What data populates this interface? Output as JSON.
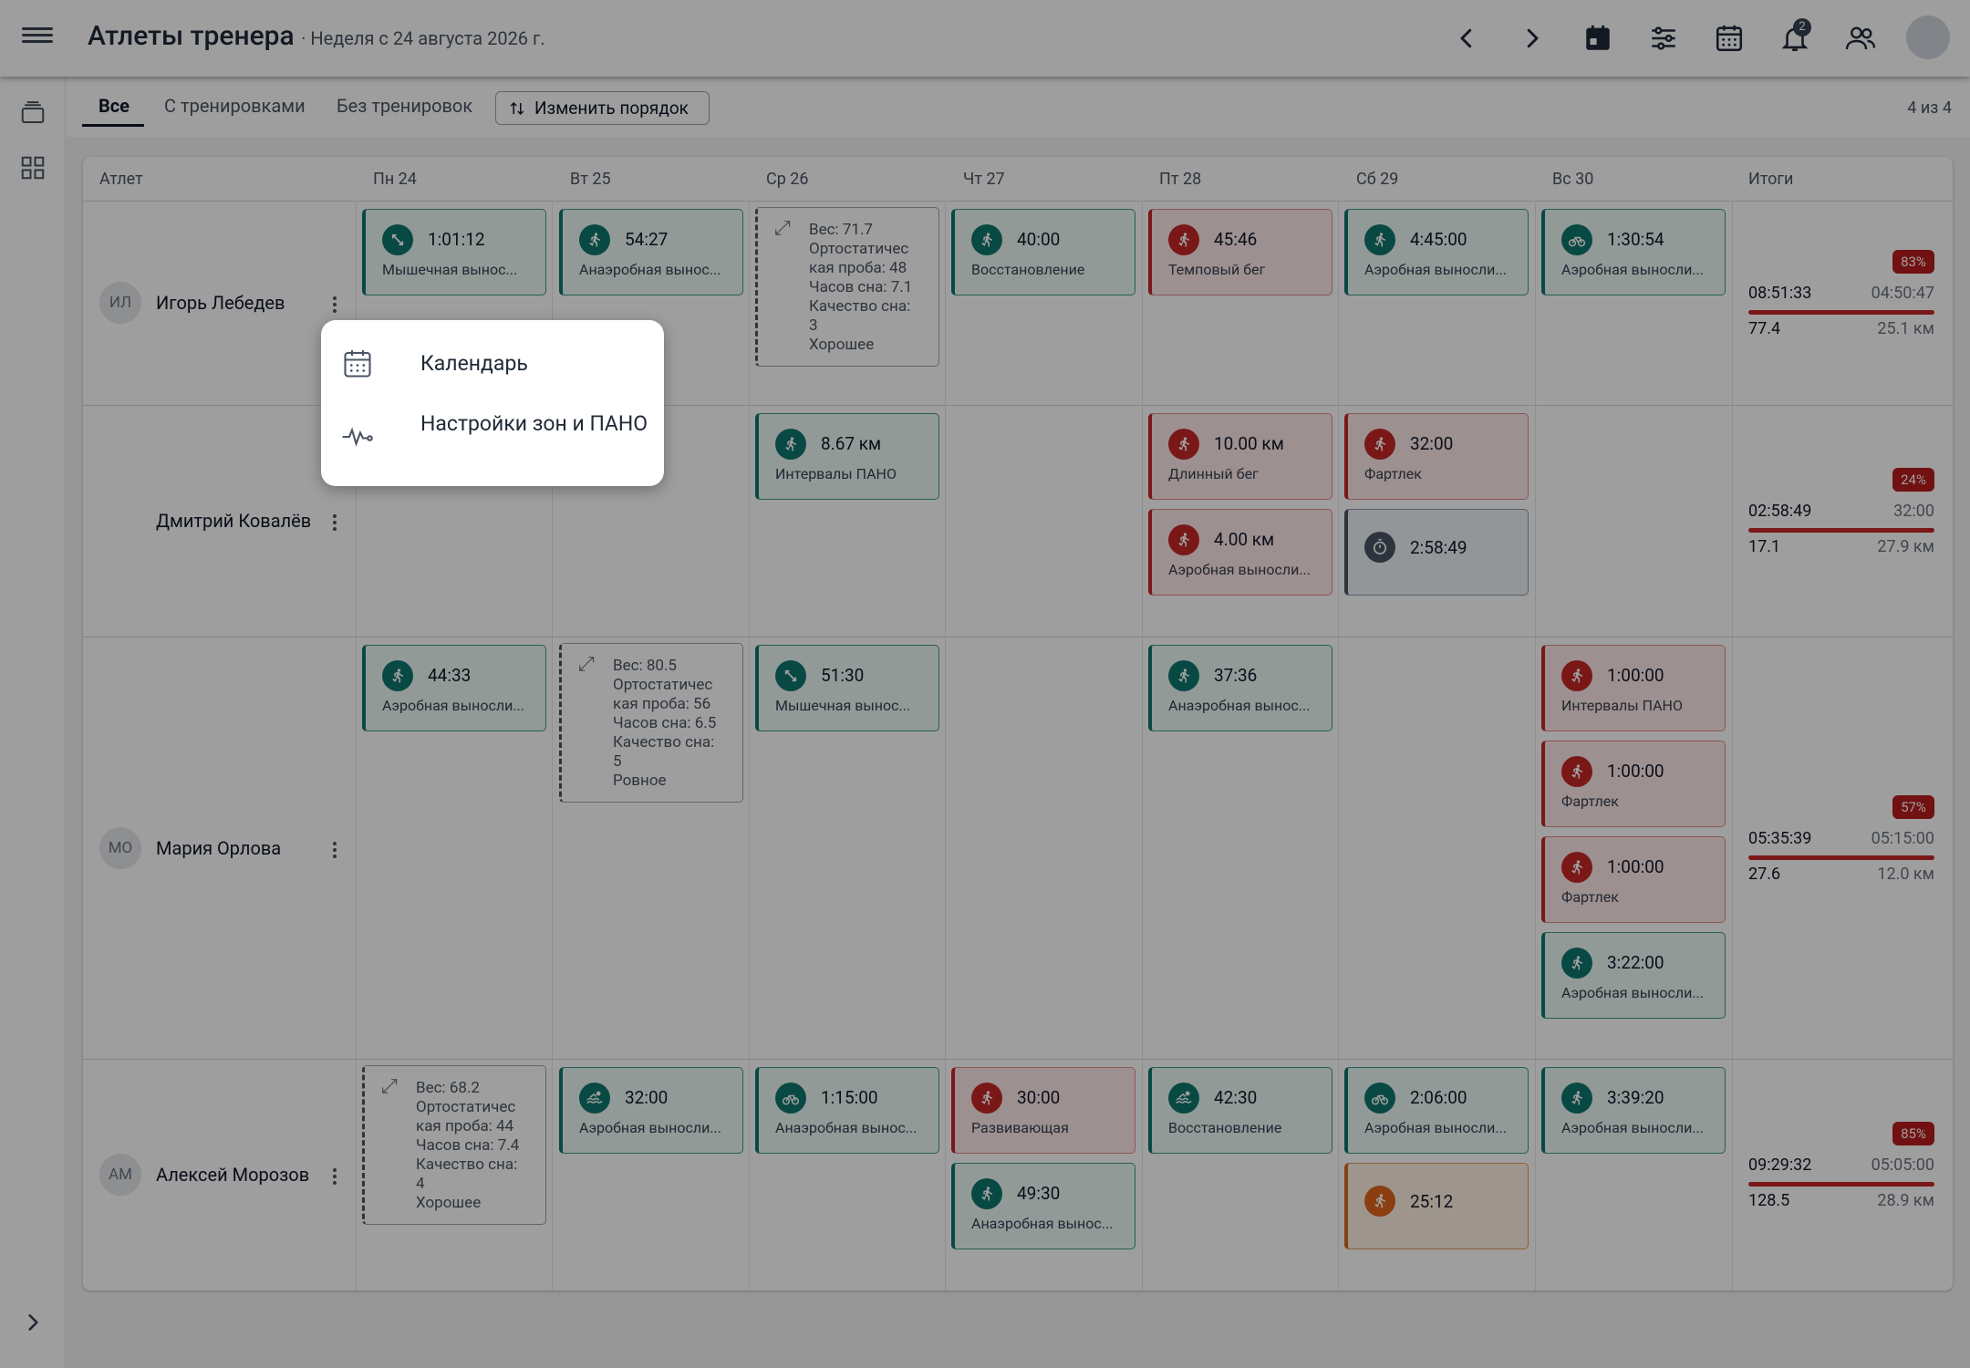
{
  "header": {
    "title": "Атлеты тренера",
    "subtitle": "· Неделя с 24 августа 2026 г.",
    "notifications_count": "2"
  },
  "tabs": [
    {
      "label": "Все",
      "active": true
    },
    {
      "label": "С тренировками",
      "active": false
    },
    {
      "label": "Без тренировок",
      "active": false
    }
  ],
  "reorder_button": "Изменить порядок",
  "count_label": "4 из 4",
  "columns": [
    "Атлет",
    "Пн 24",
    "Вт 25",
    "Ср 26",
    "Чт 27",
    "Пт 28",
    "Сб 29",
    "Вс 30",
    "Итоги"
  ],
  "athletes": [
    {
      "initials": "ИЛ",
      "name": "Игорь Лебедев",
      "workouts": [
        {
          "day": 0,
          "slot": 0,
          "value": "1:01:12",
          "name": "Мышечная вынос...",
          "color": "green",
          "icon": "strength-icon"
        },
        {
          "day": 1,
          "slot": 0,
          "value": "54:27",
          "name": "Анаэробная вынос...",
          "color": "green",
          "icon": "run-icon"
        },
        {
          "day": 3,
          "slot": 0,
          "value": "40:00",
          "name": "Восстановление",
          "color": "green",
          "icon": "run-icon"
        },
        {
          "day": 4,
          "slot": 0,
          "value": "45:46",
          "name": "Темповый бег",
          "color": "red",
          "icon": "run-icon"
        },
        {
          "day": 5,
          "slot": 0,
          "value": "4:45:00",
          "name": "Аэробная выносли...",
          "color": "green",
          "icon": "run-icon"
        },
        {
          "day": 6,
          "slot": 0,
          "value": "1:30:54",
          "name": "Аэробная выносли...",
          "color": "green",
          "icon": "bike-icon"
        }
      ],
      "note": {
        "day": 2,
        "lines": [
          "Вес: 71.7",
          "Ортостатичес",
          "кая проба: 48",
          "Часов сна: 7.1",
          "Качество сна:",
          "3",
          "Хорошее"
        ]
      },
      "summary": {
        "percent": "83%",
        "time_done": "08:51:33",
        "time_plan": "04:50:47",
        "dist_done": "77.4",
        "dist_plan": "25.1 км"
      }
    },
    {
      "initials": "",
      "name": "Дмитрий Ковалёв",
      "workouts": [
        {
          "day": 2,
          "slot": 0,
          "value": "8.67 км",
          "name": "Интервалы ПАНО",
          "color": "green",
          "icon": "run-icon"
        },
        {
          "day": 4,
          "slot": 0,
          "value": "10.00 км",
          "name": "Длинный бег",
          "color": "red",
          "icon": "run-icon"
        },
        {
          "day": 4,
          "slot": 1,
          "value": "4.00 км",
          "name": "Аэробная выносли...",
          "color": "red",
          "icon": "run-icon"
        },
        {
          "day": 5,
          "slot": 0,
          "value": "32:00",
          "name": "Фартлек",
          "color": "red",
          "icon": "run-icon"
        },
        {
          "day": 5,
          "slot": 1,
          "value": "2:58:49",
          "name": "",
          "color": "gray",
          "icon": "stopwatch-icon"
        }
      ],
      "summary": {
        "percent": "24%",
        "time_done": "02:58:49",
        "time_plan": "32:00",
        "dist_done": "17.1",
        "dist_plan": "27.9 км"
      }
    },
    {
      "initials": "МО",
      "name": "Мария Орлова",
      "workouts": [
        {
          "day": 0,
          "slot": 0,
          "value": "44:33",
          "name": "Аэробная выносли...",
          "color": "green",
          "icon": "run-icon"
        },
        {
          "day": 2,
          "slot": 0,
          "value": "51:30",
          "name": "Мышечная вынос...",
          "color": "green",
          "icon": "strength-icon"
        },
        {
          "day": 4,
          "slot": 0,
          "value": "37:36",
          "name": "Анаэробная вынос...",
          "color": "green",
          "icon": "run-icon"
        },
        {
          "day": 6,
          "slot": 0,
          "value": "1:00:00",
          "name": "Интервалы ПАНО",
          "color": "red",
          "icon": "run-icon"
        },
        {
          "day": 6,
          "slot": 1,
          "value": "1:00:00",
          "name": "Фартлек",
          "color": "red",
          "icon": "run-icon"
        },
        {
          "day": 6,
          "slot": 2,
          "value": "1:00:00",
          "name": "Фартлек",
          "color": "red",
          "icon": "run-icon"
        },
        {
          "day": 6,
          "slot": 3,
          "value": "3:22:00",
          "name": "Аэробная выносли...",
          "color": "green",
          "icon": "run-icon"
        }
      ],
      "note": {
        "day": 1,
        "lines": [
          "Вес: 80.5",
          "Ортостатичес",
          "кая проба: 56",
          "Часов сна: 6.5",
          "Качество сна:",
          "5",
          "Ровное"
        ]
      },
      "summary": {
        "percent": "57%",
        "time_done": "05:35:39",
        "time_plan": "05:15:00",
        "dist_done": "27.6",
        "dist_plan": "12.0 км"
      }
    },
    {
      "initials": "АМ",
      "name": "Алексей Морозов",
      "workouts": [
        {
          "day": 1,
          "slot": 0,
          "value": "32:00",
          "name": "Аэробная выносли...",
          "color": "green",
          "icon": "swim-icon"
        },
        {
          "day": 2,
          "slot": 0,
          "value": "1:15:00",
          "name": "Анаэробная вынос...",
          "color": "green",
          "icon": "bike-icon"
        },
        {
          "day": 3,
          "slot": 0,
          "value": "30:00",
          "name": "Развивающая",
          "color": "red",
          "icon": "run-icon"
        },
        {
          "day": 3,
          "slot": 1,
          "value": "49:30",
          "name": "Анаэробная вынос...",
          "color": "green",
          "icon": "run-icon"
        },
        {
          "day": 4,
          "slot": 0,
          "value": "42:30",
          "name": "Восстановление",
          "color": "green",
          "icon": "swim-icon"
        },
        {
          "day": 5,
          "slot": 0,
          "value": "2:06:00",
          "name": "Аэробная выносли...",
          "color": "green",
          "icon": "bike-icon"
        },
        {
          "day": 5,
          "slot": 1,
          "value": "25:12",
          "name": "",
          "color": "orange",
          "icon": "run-icon"
        },
        {
          "day": 6,
          "slot": 0,
          "value": "3:39:20",
          "name": "Аэробная выносли...",
          "color": "green",
          "icon": "run-icon"
        }
      ],
      "note": {
        "day": 0,
        "lines": [
          "Вес: 68.2",
          "Ортостатичес",
          "кая проба: 44",
          "Часов сна: 7.4",
          "Качество сна:",
          "4",
          "Хорошее"
        ]
      },
      "summary": {
        "percent": "85%",
        "time_done": "09:29:32",
        "time_plan": "05:05:00",
        "dist_done": "128.5",
        "dist_plan": "28.9 км"
      }
    }
  ],
  "popup_menu": {
    "items": [
      {
        "label": "Календарь",
        "icon": "calendar-icon"
      },
      {
        "label": "Настройки зон и ПАНО",
        "icon": "heart-rate-icon"
      }
    ]
  }
}
